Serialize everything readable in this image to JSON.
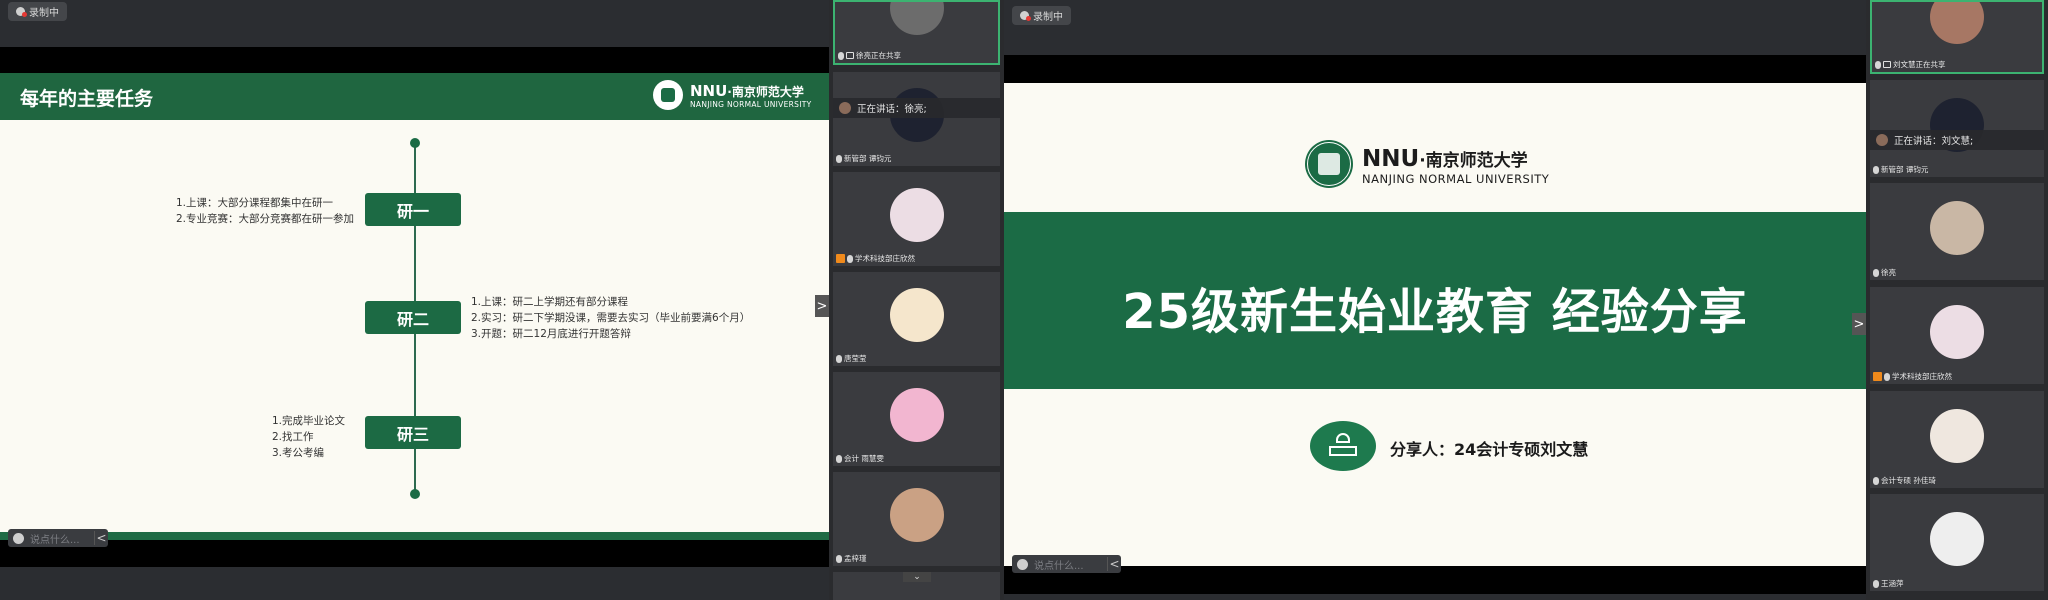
{
  "left_window": {
    "recording_label": "录制中",
    "slide": {
      "title": "每年的主要任务",
      "logo_en": "NNU",
      "logo_cn": "·南京师范大学",
      "logo_sub": "NANJING NORMAL UNIVERSITY",
      "stages": [
        {
          "label": "研一",
          "note": "1.上课：大部分课程都集中在研一\n2.专业竞赛：大部分竞赛都在研一参加"
        },
        {
          "label": "研二",
          "note": "1.上课：研二上学期还有部分课程\n2.实习：研二下学期没课，需要去实习（毕业前要满6个月）\n3.开题：研二12月底进行开题答辩"
        },
        {
          "label": "研三",
          "note": "1.完成毕业论文\n2.找工作\n3.考公考编"
        }
      ]
    },
    "chat_placeholder": "说点什么...",
    "chat_toggle": "<"
  },
  "left_panel": {
    "speaking": "正在讲话：徐亮;",
    "participants": [
      {
        "name": "徐亮正在共享",
        "color": "#8a8a8a"
      },
      {
        "name": "新管部 谭钧元",
        "color": "#223"
      },
      {
        "name": "学术科技部庄欣然",
        "color": "#e8d6de"
      },
      {
        "name": "唐莹莹",
        "color": "#f4e2c8"
      },
      {
        "name": "会计 雨慧雯",
        "color": "#f5b3cf"
      },
      {
        "name": "孟梓瑾",
        "color": "#c99c7d"
      }
    ],
    "expand_arrow": ">"
  },
  "right_window": {
    "recording_label": "录制中",
    "slide": {
      "logo_en": "NNU",
      "logo_cn": "·南京师范大学",
      "logo_sub": "NANJING NORMAL UNIVERSITY",
      "banner": "25级新生始业教育 经验分享",
      "presenter": "分享人：24会计专硕刘文慧"
    },
    "chat_placeholder": "说点什么...",
    "chat_toggle": "<"
  },
  "right_panel": {
    "speaking": "正在讲话：刘文慧;",
    "participants": [
      {
        "name": "刘文慧正在共享",
        "color": "#a07060"
      },
      {
        "name": "新管部 谭钧元",
        "color": "#223"
      },
      {
        "name": "徐亮",
        "color": "#c8b8a8"
      },
      {
        "name": "学术科技部庄欣然",
        "color": "#e8d6de"
      },
      {
        "name": "会计专硕 孙佳琦",
        "color": "#efe7df"
      },
      {
        "name": "王涵萍",
        "color": "#eeeeee"
      }
    ],
    "expand_arrow": ">"
  }
}
